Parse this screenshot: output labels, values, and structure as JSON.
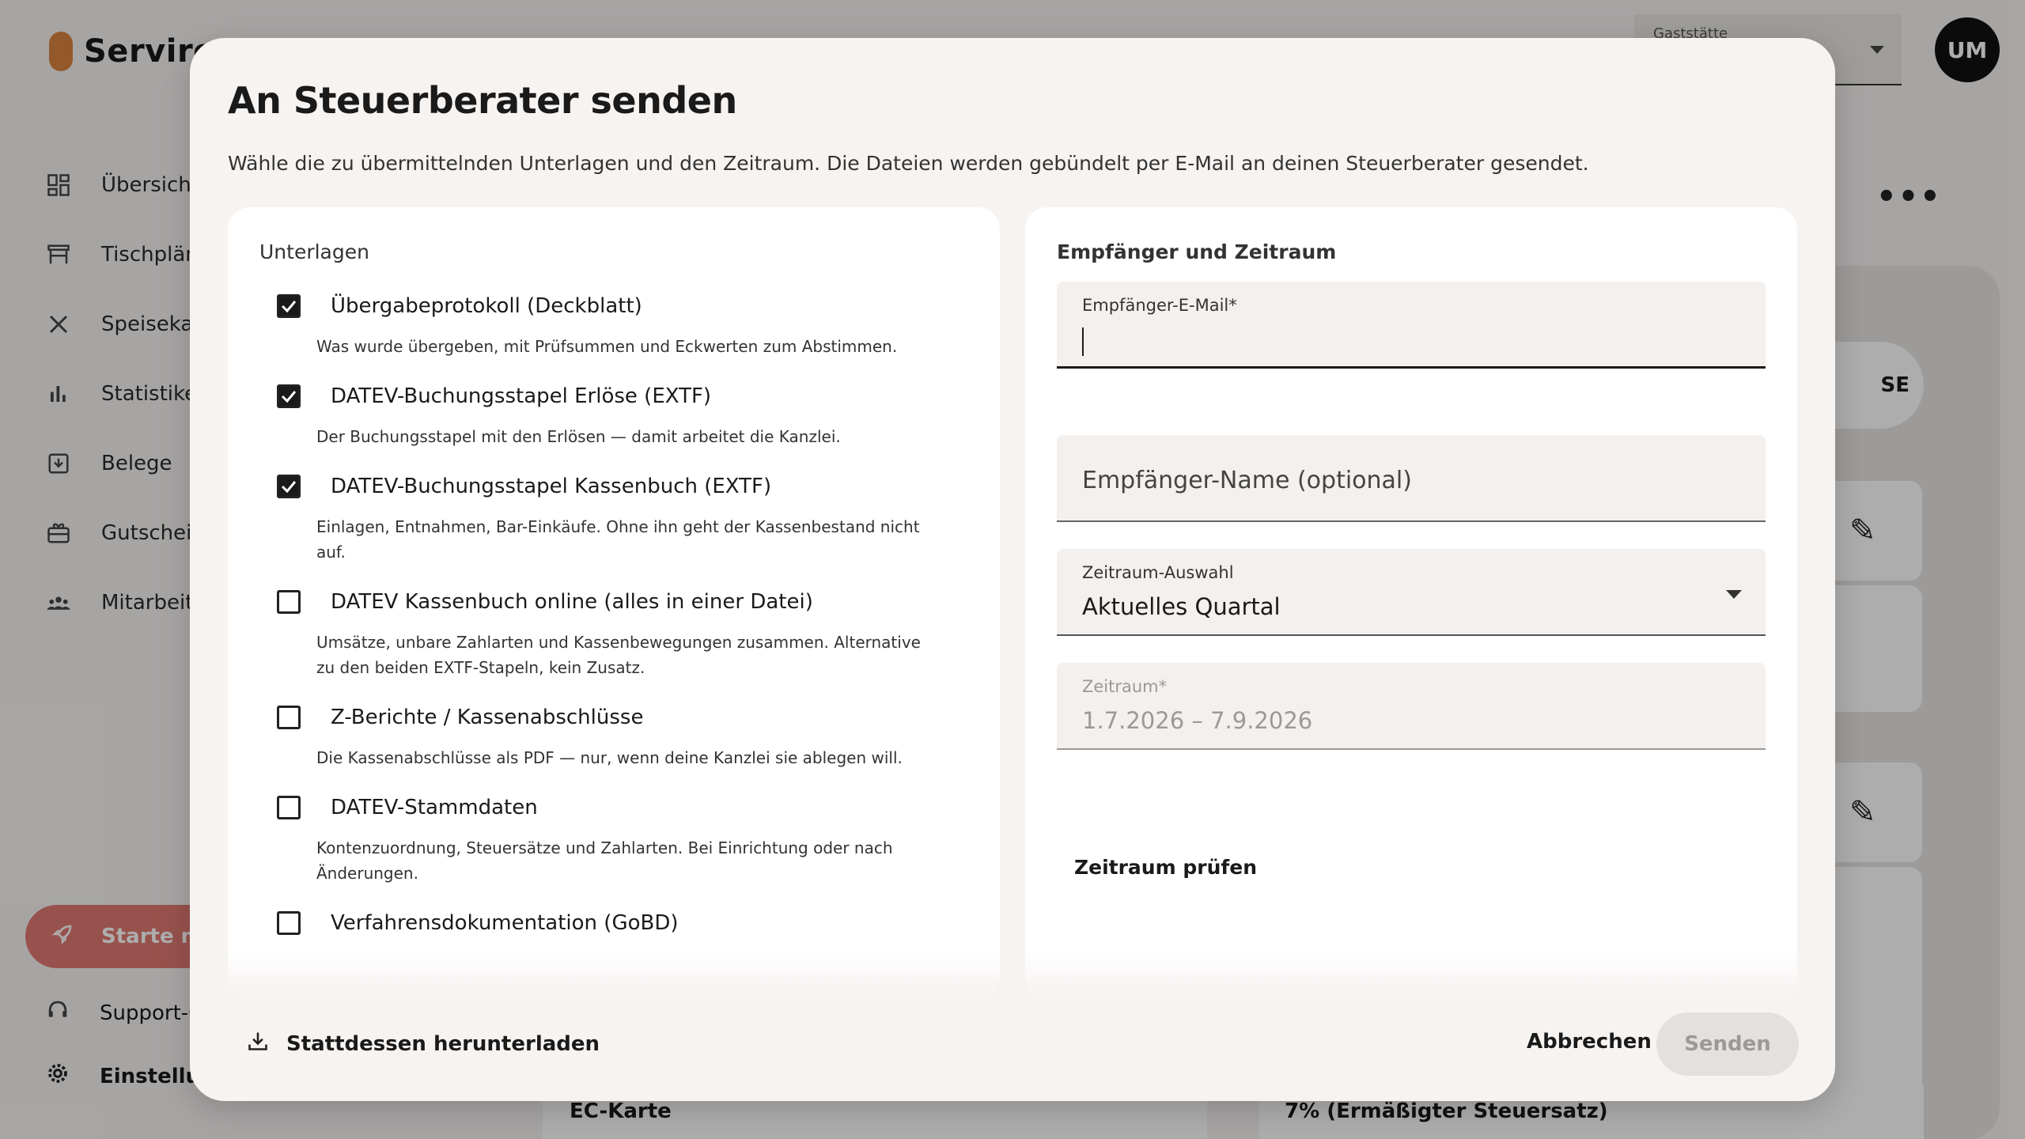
{
  "app": {
    "brand": "Servire",
    "nav": [
      "Übersicht",
      "Tischplän",
      "Speisekar",
      "Statistike",
      "Belege",
      "Gutschein",
      "Mitarbeite"
    ],
    "start_label": "Starte mit",
    "support_label": "Support-C",
    "settings_label": "Einstellung",
    "venue_label": "Gaststätte",
    "avatar": "UM",
    "pill_text": "SE",
    "table_cell_1": "EC-Karte",
    "table_cell_2": "7% (Ermäßigter Steuersatz)"
  },
  "modal": {
    "title": "An Steuerberater senden",
    "description": "Wähle die zu übermittelnden Unterlagen und den Zeitraum. Die Dateien werden gebündelt per E-Mail an deinen Steuerberater gesendet.",
    "documents_title": "Unterlagen",
    "documents": [
      {
        "label": "Übergabeprotokoll (Deckblatt)",
        "description": "Was wurde übergeben, mit Prüfsummen und Eckwerten zum Abstimmen.",
        "checked": true
      },
      {
        "label": "DATEV-Buchungsstapel Erlöse (EXTF)",
        "description": "Der Buchungsstapel mit den Erlösen — damit arbeitet die Kanzlei.",
        "checked": true
      },
      {
        "label": "DATEV-Buchungsstapel Kassenbuch (EXTF)",
        "description": "Einlagen, Entnahmen, Bar-Einkäufe. Ohne ihn geht der Kassenbestand nicht auf.",
        "checked": true
      },
      {
        "label": "DATEV Kassenbuch online (alles in einer Datei)",
        "description": "Umsätze, unbare Zahlarten und Kassenbewegungen zusammen. Alternative zu den beiden EXTF-Stapeln, kein Zusatz.",
        "checked": false
      },
      {
        "label": "Z-Berichte / Kassenabschlüsse",
        "description": "Die Kassenabschlüsse als PDF — nur, wenn deine Kanzlei sie ablegen will.",
        "checked": false
      },
      {
        "label": "DATEV-Stammdaten",
        "description": "Kontenzuordnung, Steuersätze und Zahlarten. Bei Einrichtung oder nach Änderungen.",
        "checked": false
      },
      {
        "label": "Verfahrensdokumentation (GoBD)",
        "description": "",
        "checked": false
      }
    ],
    "recipient_title": "Empfänger und Zeitraum",
    "email_label": "Empfänger-E-Mail*",
    "email_value": "",
    "name_placeholder": "Empfänger-Name (optional)",
    "period_label": "Zeitraum-Auswahl",
    "period_value": "Aktuelles Quartal",
    "range_label": "Zeitraum*",
    "range_value": "1.7.2026 – 7.9.2026",
    "check_range": "Zeitraum prüfen",
    "download_label": "Stattdessen herunterladen",
    "cancel_label": "Abbrechen",
    "send_label": "Senden"
  }
}
